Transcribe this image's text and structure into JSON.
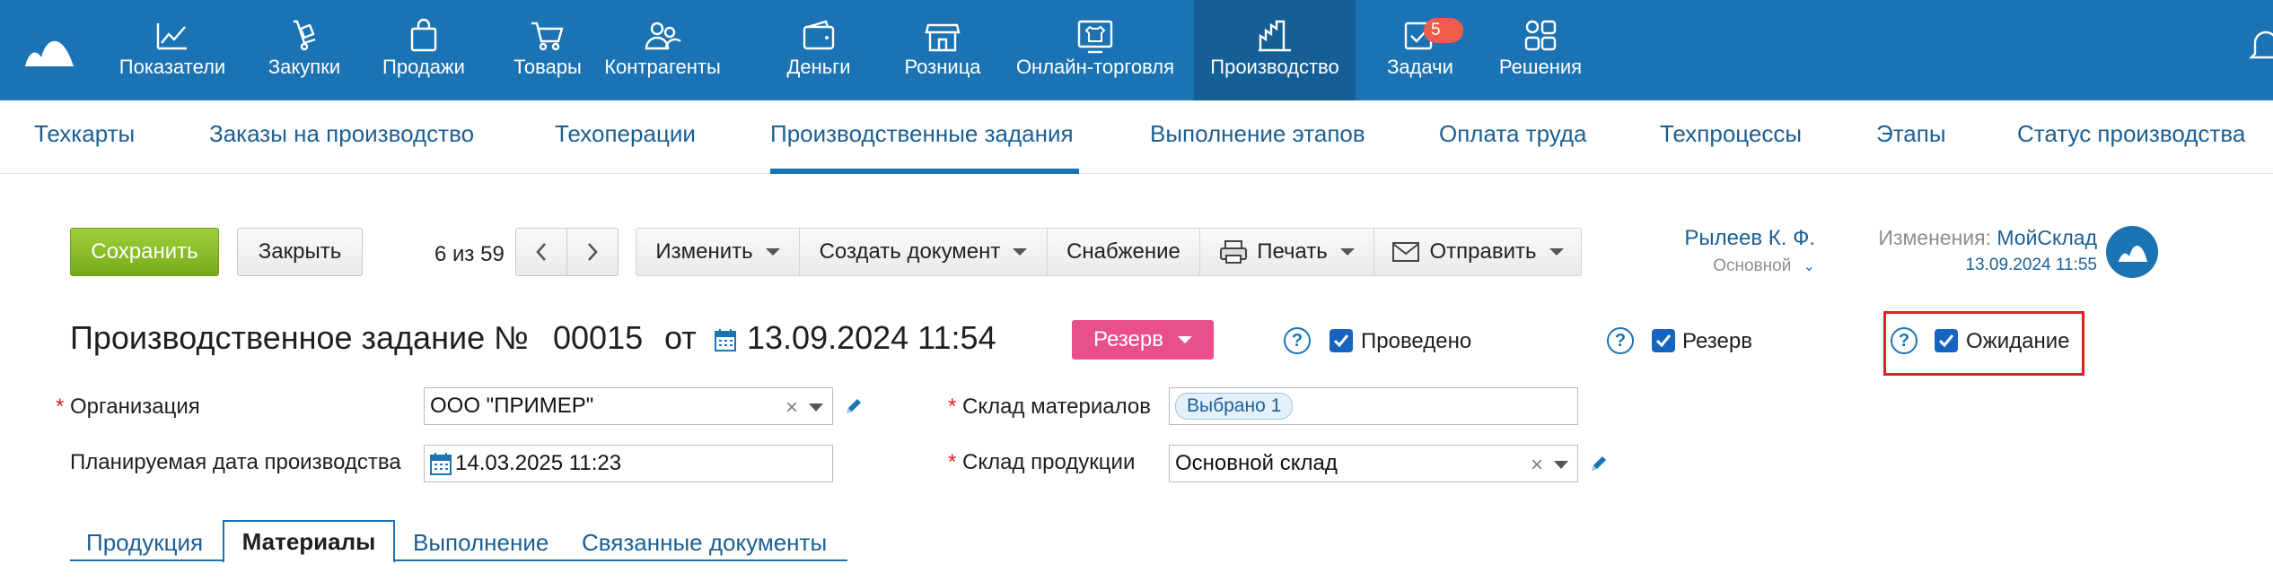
{
  "topnav": {
    "items": [
      {
        "label": "Показатели",
        "icon": "chart-icon"
      },
      {
        "label": "Закупки",
        "icon": "cart-dolly-icon"
      },
      {
        "label": "Продажи",
        "icon": "shopping-bag-icon"
      },
      {
        "label": "Товары",
        "icon": "cart-icon"
      },
      {
        "label": "Контрагенты",
        "icon": "people-icon"
      },
      {
        "label": "Деньги",
        "icon": "wallet-icon"
      },
      {
        "label": "Розница",
        "icon": "store-icon"
      },
      {
        "label": "Онлайн-торговля",
        "icon": "tshirt-screen-icon"
      },
      {
        "label": "Производство",
        "icon": "factory-icon"
      },
      {
        "label": "Задачи",
        "icon": "task-check-icon",
        "badge": "5"
      },
      {
        "label": "Решения",
        "icon": "apps-grid-icon"
      }
    ],
    "active": "Производство"
  },
  "subnav": {
    "items": [
      "Техкарты",
      "Заказы на производство",
      "Техоперации",
      "Производственные задания",
      "Выполнение этапов",
      "Оплата труда",
      "Техпроцессы",
      "Этапы",
      "Статус производства"
    ],
    "active": "Производственные задания"
  },
  "toolbar": {
    "save_label": "Сохранить",
    "close_label": "Закрыть",
    "counter": "6 из 59",
    "edit_label": "Изменить",
    "create_doc_label": "Создать документ",
    "supply_label": "Снабжение",
    "print_label": "Печать",
    "send_label": "Отправить"
  },
  "user": {
    "name": "Рылеев К. Ф.",
    "role": "Основной",
    "changes_prefix": "Изменения:",
    "changes_by": "МойСклад",
    "changes_time": "13.09.2024 11:55"
  },
  "document": {
    "title": "Производственное задание №",
    "number": "00015",
    "from_label": "от",
    "date": "13.09.2024 11:54",
    "reserve_button": "Резерв",
    "flags": [
      {
        "label": "Проведено",
        "checked": true
      },
      {
        "label": "Резерв",
        "checked": true
      },
      {
        "label": "Ожидание",
        "checked": true
      }
    ]
  },
  "form": {
    "organization_label": "Организация",
    "organization_value": "ООО \"ПРИМЕР\"",
    "planned_date_label": "Планируемая дата производства",
    "planned_date_value": "14.03.2025 11:23",
    "materials_warehouse_label": "Склад материалов",
    "materials_warehouse_value": "Выбрано 1",
    "products_warehouse_label": "Склад продукции",
    "products_warehouse_value": "Основной склад"
  },
  "tabs": {
    "items": [
      "Продукция",
      "Материалы",
      "Выполнение",
      "Связанные документы"
    ],
    "active": "Материалы"
  },
  "colors": {
    "topbar": "#1b73b3",
    "topbar_active": "#155f96",
    "save_button": "#8bc12b",
    "reserve_button": "#ea4f8d",
    "badge": "#f05b4b",
    "highlight": "#e02020"
  }
}
